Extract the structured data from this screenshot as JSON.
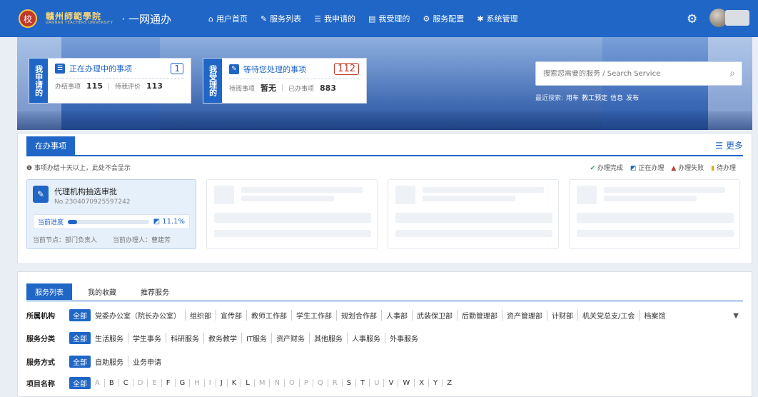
{
  "topbar": {
    "logo_glyph": "校",
    "brand_cn": "贛州師範學院",
    "brand_en": "GANNAN TEACHERS UNIVERSITY",
    "portal": "· 一网通办",
    "nav": [
      {
        "icon": "home-icon",
        "glyph": "⌂",
        "label": "用户首页"
      },
      {
        "icon": "edit-icon",
        "glyph": "✎",
        "label": "服务列表"
      },
      {
        "icon": "list-icon",
        "glyph": "☰",
        "label": "我申请的"
      },
      {
        "icon": "inbox-icon",
        "glyph": "▤",
        "label": "我受理的"
      },
      {
        "icon": "config-icon",
        "glyph": "⚙",
        "label": "服务配置"
      },
      {
        "icon": "system-icon",
        "glyph": "✱",
        "label": "系统管理"
      }
    ]
  },
  "hero": {
    "card_apply": {
      "side": "我申请的",
      "title": "正在办理中的事项",
      "count": "1",
      "done_label": "办结事项",
      "done_value": "115",
      "eval_label": "待我评价",
      "eval_value": "113"
    },
    "card_handle": {
      "side": "我受理的",
      "title": "等待您处理的事项",
      "count": "112",
      "wait_label": "待阅事项",
      "wait_value": "暂无",
      "handled_label": "已办事项",
      "handled_value": "883"
    },
    "search": {
      "placeholder": "搜索您需要的服务 / Search Service",
      "recent_label": "最近搜索:",
      "recent": [
        "用车",
        "教工预定",
        "信息",
        "发布"
      ]
    }
  },
  "inprogress": {
    "tab": "在办事项",
    "more": "更多",
    "notice": "❶ 事项办结十天以上，此处不会显示",
    "legend": [
      {
        "glyph": "✔",
        "label": "办理完成",
        "color": "#3aa55b"
      },
      {
        "glyph": "◩",
        "label": "正在办理",
        "color": "#1f66c6"
      },
      {
        "glyph": "▲",
        "label": "办理失败",
        "color": "#c0392b"
      },
      {
        "glyph": "▮",
        "label": "待办理",
        "color": "#e5a922"
      }
    ],
    "task": {
      "title": "代理机构抽选审批",
      "no": "No.2304070925597242",
      "progress_label": "当前进度",
      "progress": 0.111,
      "progress_text": "11.1%",
      "node": "当前节点：部门负责人",
      "handler": "当前办理人：曹建芳"
    }
  },
  "services": {
    "tabs": [
      "服务列表",
      "我的收藏",
      "推荐服务"
    ],
    "all": "全部",
    "rows": [
      {
        "label": "所属机构",
        "options": [
          "党委办公室（院长办公室）",
          "组织部",
          "宣传部",
          "教师工作部",
          "学生工作部",
          "规划合作部",
          "人事部",
          "武装保卫部",
          "后勤管理部",
          "资产管理部",
          "计财部",
          "机关党总支/工会",
          "档案馆"
        ]
      },
      {
        "label": "服务分类",
        "options": [
          "生活服务",
          "学生事务",
          "科研服务",
          "教务教学",
          "IT服务",
          "资产财务",
          "其他服务",
          "人事服务",
          "外事服务"
        ]
      },
      {
        "label": "服务方式",
        "options": [
          "自助服务",
          "业务申请"
        ]
      },
      {
        "label": "项目名称",
        "options": [
          "A",
          "B",
          "C",
          "D",
          "E",
          "F",
          "G",
          "H",
          "I",
          "J",
          "K",
          "L",
          "M",
          "N",
          "O",
          "P",
          "Q",
          "R",
          "S",
          "T",
          "U",
          "V",
          "W",
          "X",
          "Y",
          "Z"
        ]
      }
    ],
    "dim_letters": [
      "A",
      "D",
      "E",
      "H",
      "I",
      "M",
      "N",
      "O",
      "P",
      "Q",
      "R",
      "U"
    ]
  }
}
